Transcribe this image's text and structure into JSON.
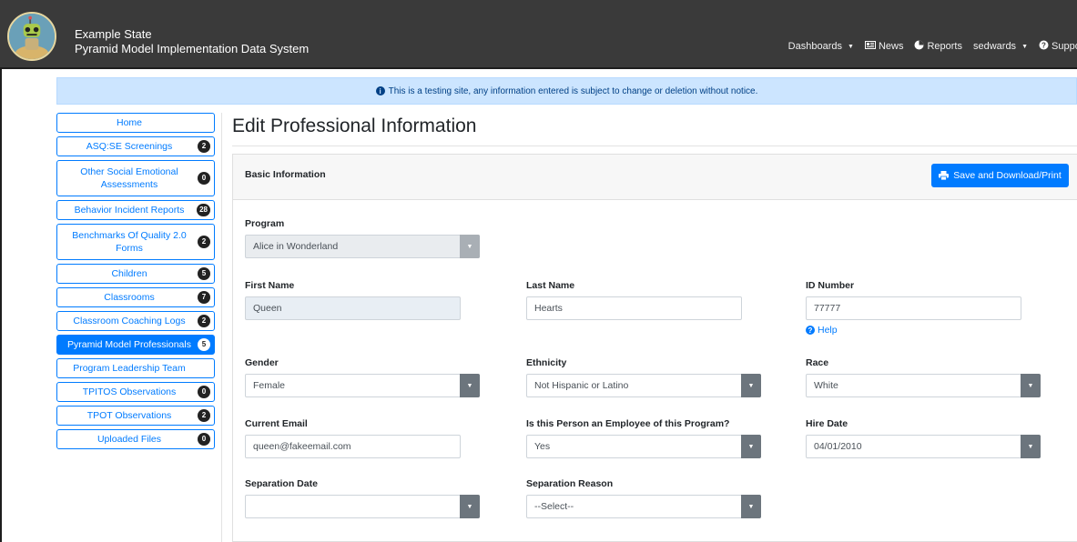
{
  "header": {
    "brand_line1": "Example State",
    "brand_line2": "Pyramid Model Implementation Data System",
    "nav": {
      "dashboards": "Dashboards",
      "news": "News",
      "reports": "Reports",
      "user": "sedwards",
      "support": "Support"
    }
  },
  "alert": {
    "icon": "info-circle-icon",
    "text": "This is a testing site, any information entered is subject to change or deletion without notice."
  },
  "sidebar": {
    "items": [
      {
        "label": "Home",
        "badge": ""
      },
      {
        "label": "ASQ:SE Screenings",
        "badge": "2"
      },
      {
        "label": "Other Social Emotional Assessments",
        "badge": "0"
      },
      {
        "label": "Behavior Incident Reports",
        "badge": "28"
      },
      {
        "label": "Benchmarks Of Quality 2.0 Forms",
        "badge": "2"
      },
      {
        "label": "Children",
        "badge": "5"
      },
      {
        "label": "Classrooms",
        "badge": "7"
      },
      {
        "label": "Classroom Coaching Logs",
        "badge": "2"
      },
      {
        "label": "Pyramid Model Professionals",
        "badge": "5",
        "active": true
      },
      {
        "label": "Program Leadership Team",
        "badge": ""
      },
      {
        "label": "TPITOS Observations",
        "badge": "0"
      },
      {
        "label": "TPOT Observations",
        "badge": "2"
      },
      {
        "label": "Uploaded Files",
        "badge": "0"
      }
    ]
  },
  "page": {
    "title": "Edit Professional Information",
    "section_title": "Basic Information",
    "save_label": "Save and Download/Print"
  },
  "form": {
    "program": {
      "label": "Program",
      "value": "Alice in Wonderland"
    },
    "first_name": {
      "label": "First Name",
      "value": "Queen"
    },
    "last_name": {
      "label": "Last Name",
      "value": "Hearts"
    },
    "id_number": {
      "label": "ID Number",
      "value": "77777",
      "help": "Help"
    },
    "gender": {
      "label": "Gender",
      "value": "Female"
    },
    "ethnicity": {
      "label": "Ethnicity",
      "value": "Not Hispanic or Latino"
    },
    "race": {
      "label": "Race",
      "value": "White"
    },
    "email": {
      "label": "Current Email",
      "value": "queen@fakeemail.com"
    },
    "employee": {
      "label": "Is this Person an Employee of this Program?",
      "value": "Yes"
    },
    "hire_date": {
      "label": "Hire Date",
      "value": "04/01/2010"
    },
    "separation_date": {
      "label": "Separation Date",
      "value": ""
    },
    "separation_reason": {
      "label": "Separation Reason",
      "value": "--Select--"
    }
  },
  "colors": {
    "primary": "#007bff",
    "header_bg": "#3a3a3a",
    "alert_bg": "#cce5ff",
    "select_button": "#6c757d"
  }
}
